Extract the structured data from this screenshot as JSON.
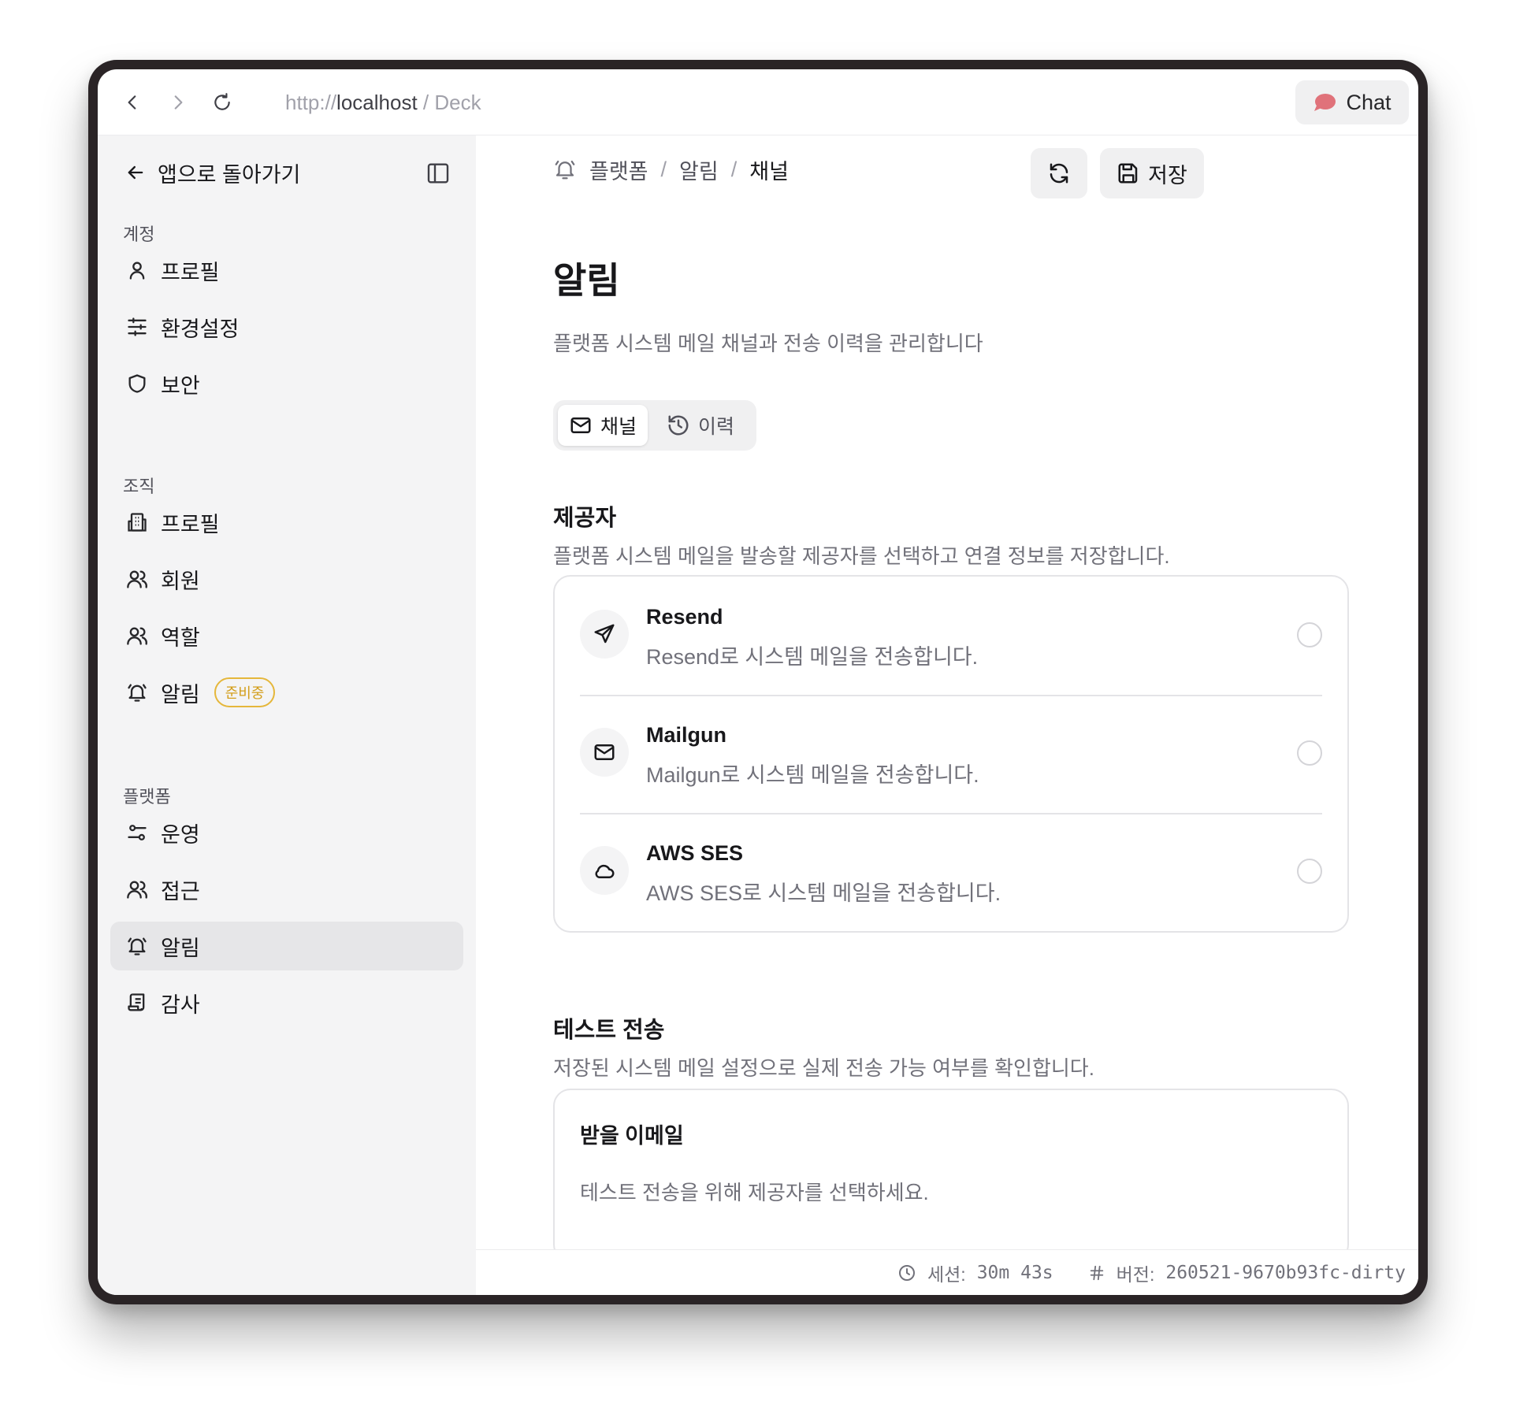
{
  "browser": {
    "url_scheme": "http://",
    "url_host": "localhost",
    "url_suffix": " / Deck",
    "chat_label": "Chat",
    "chat_icon_color": "#e0727a"
  },
  "sidebar": {
    "back_label": "앱으로 돌아가기",
    "sections": {
      "account": "계정",
      "org": "조직",
      "platform": "플랫폼"
    },
    "items": {
      "account_profile": "프로필",
      "preferences": "환경설정",
      "security": "보안",
      "org_profile": "프로필",
      "members": "회원",
      "roles": "역할",
      "org_notifications": "알림",
      "org_notifications_badge": "준비중",
      "operations": "운영",
      "access": "접근",
      "platform_notifications": "알림",
      "audit": "감사"
    }
  },
  "header": {
    "breadcrumb": [
      "플랫폼",
      "알림",
      "채널"
    ],
    "save_label": "저장"
  },
  "page": {
    "title": "알림",
    "description": "플랫폼 시스템 메일 채널과 전송 이력을 관리합니다",
    "tabs": {
      "channel": "채널",
      "history": "이력"
    }
  },
  "providers": {
    "heading": "제공자",
    "description": "플랫폼 시스템 메일을 발송할 제공자를 선택하고 연결 정보를 저장합니다.",
    "items": [
      {
        "name": "Resend",
        "desc": "Resend로 시스템 메일을 전송합니다.",
        "icon": "send-icon"
      },
      {
        "name": "Mailgun",
        "desc": "Mailgun로 시스템 메일을 전송합니다.",
        "icon": "mail-icon"
      },
      {
        "name": "AWS SES",
        "desc": "AWS SES로 시스템 메일을 전송합니다.",
        "icon": "cloud-icon"
      }
    ]
  },
  "test_send": {
    "heading": "테스트 전송",
    "description": "저장된 시스템 메일 설정으로 실제 전송 가능 여부를 확인합니다.",
    "recipient_label": "받을 이메일",
    "recipient_hint": "테스트 전송을 위해 제공자를 선택하세요."
  },
  "footer": {
    "session_label": "세션:",
    "session_value": "30m 43s",
    "version_label": "버전:",
    "version_value": "260521-9670b93fc-dirty"
  }
}
